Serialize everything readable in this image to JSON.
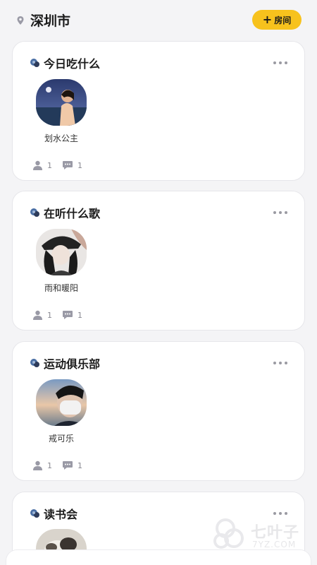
{
  "header": {
    "city": "深圳市",
    "add_room_label": "房间",
    "icons": {
      "location": "location-pin-icon",
      "add": "plus-icon"
    }
  },
  "rooms": [
    {
      "title": "今日吃什么",
      "member": "划水公主",
      "people_count": "1",
      "comment_count": "1"
    },
    {
      "title": "在听什么歌",
      "member": "雨和暖阳",
      "people_count": "1",
      "comment_count": "1"
    },
    {
      "title": "运动俱乐部",
      "member": "戒可乐",
      "people_count": "1",
      "comment_count": "1"
    },
    {
      "title": "读书会",
      "member": "",
      "people_count": "",
      "comment_count": ""
    }
  ],
  "watermark": {
    "main": "七叶子",
    "sub": "7YZ.COM"
  },
  "colors": {
    "accent": "#f7c21d",
    "background": "#f4f4f6",
    "card": "#ffffff",
    "muted": "#8a8a92"
  }
}
